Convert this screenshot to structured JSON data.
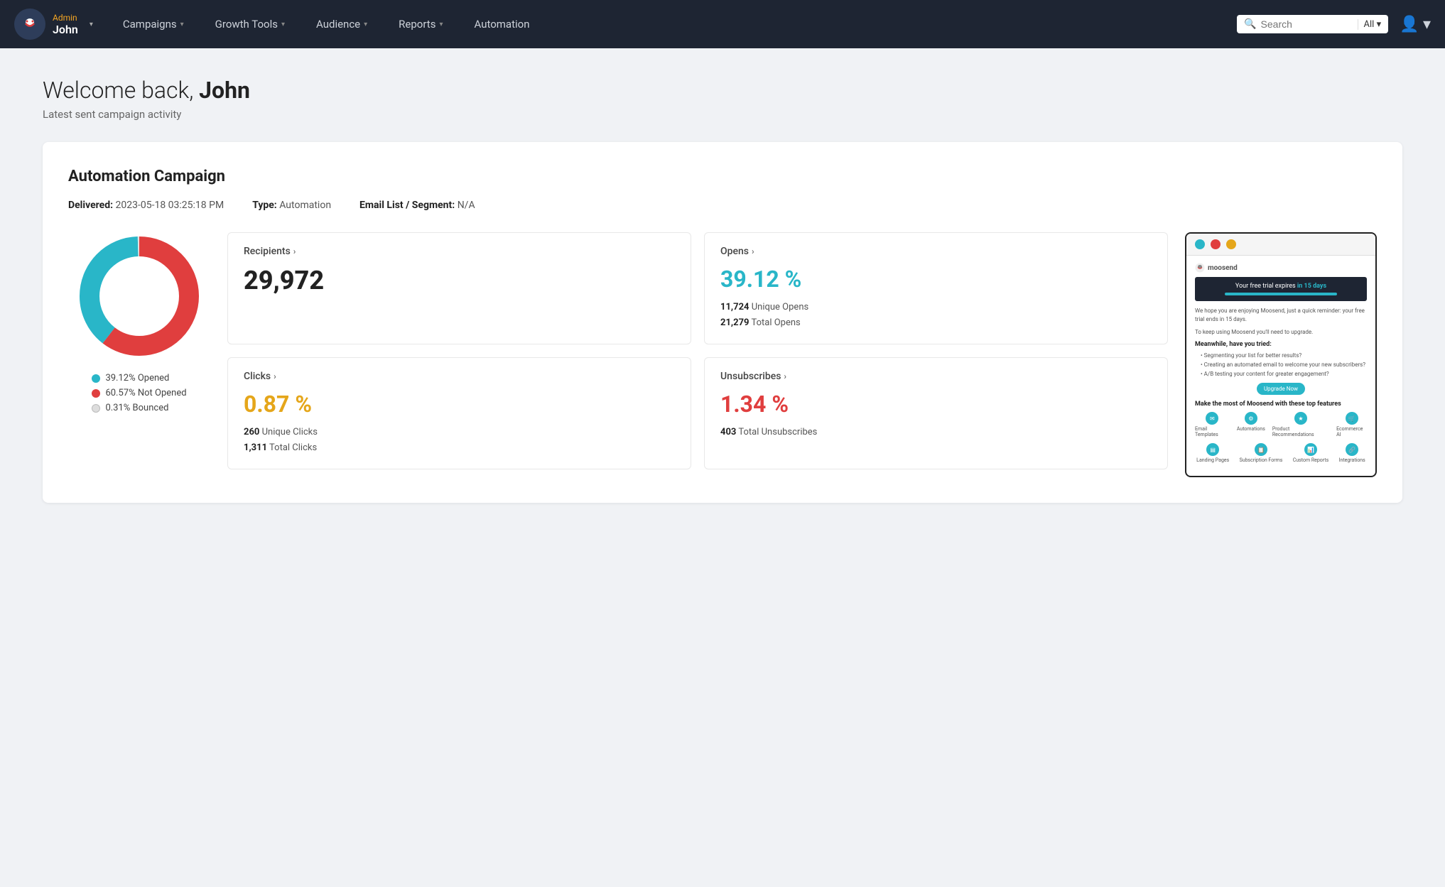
{
  "nav": {
    "admin_label": "Admin",
    "username": "John",
    "campaigns_label": "Campaigns",
    "growth_tools_label": "Growth Tools",
    "audience_label": "Audience",
    "reports_label": "Reports",
    "automation_label": "Automation",
    "search_placeholder": "Search",
    "search_filter": "All"
  },
  "header": {
    "welcome": "Welcome back, ",
    "username": "John",
    "subtitle": "Latest sent campaign activity"
  },
  "campaign": {
    "title": "Automation Campaign",
    "delivered_label": "Delivered:",
    "delivered_value": "2023-05-18 03:25:18 PM",
    "type_label": "Type:",
    "type_value": "Automation",
    "segment_label": "Email List / Segment:",
    "segment_value": "N/A"
  },
  "stats": {
    "recipients": {
      "label": "Recipients",
      "value": "29,972"
    },
    "opens": {
      "label": "Opens",
      "pct": "39.12 %",
      "unique_label": "Unique Opens",
      "unique_value": "11,724",
      "total_label": "Total Opens",
      "total_value": "21,279"
    },
    "clicks": {
      "label": "Clicks",
      "pct": "0.87 %",
      "unique_label": "Unique Clicks",
      "unique_value": "260",
      "total_label": "Total Clicks",
      "total_value": "1,311"
    },
    "unsubscribes": {
      "label": "Unsubscribes",
      "pct": "1.34 %",
      "total_label": "Total Unsubscribes",
      "total_value": "403"
    }
  },
  "legend": {
    "opened": "39.12% Opened",
    "not_opened": "60.57% Not Opened",
    "bounced": "0.31% Bounced"
  },
  "colors": {
    "teal": "#29b6c8",
    "red": "#e03e3e",
    "light_gray": "#ddd",
    "gold": "#e5a61a"
  },
  "preview": {
    "banner_text": "Your free trial expires",
    "banner_strong": "in 15 days",
    "logo_text": "moosend",
    "body_text1": "We hope you are enjoying Moosend, just a quick reminder: your free trial ends in 15 days.",
    "body_text2": "To keep using Moosend you'll need to upgrade.",
    "heading": "Meanwhile, have you tried:",
    "list": [
      "Segmenting your list for better results?",
      "Creating an automated email to welcome your new subscribers?",
      "A/B testing your content for greater engagement?"
    ],
    "btn_label": "Upgrade Now",
    "features_title": "Make the most of Moosend with these top features",
    "features": [
      "Email Templates",
      "Automations",
      "Product Recommendations",
      "Ecommerce AI",
      "Landing Pages",
      "Subscription Forms",
      "Custom Reports",
      "Integrations"
    ]
  }
}
